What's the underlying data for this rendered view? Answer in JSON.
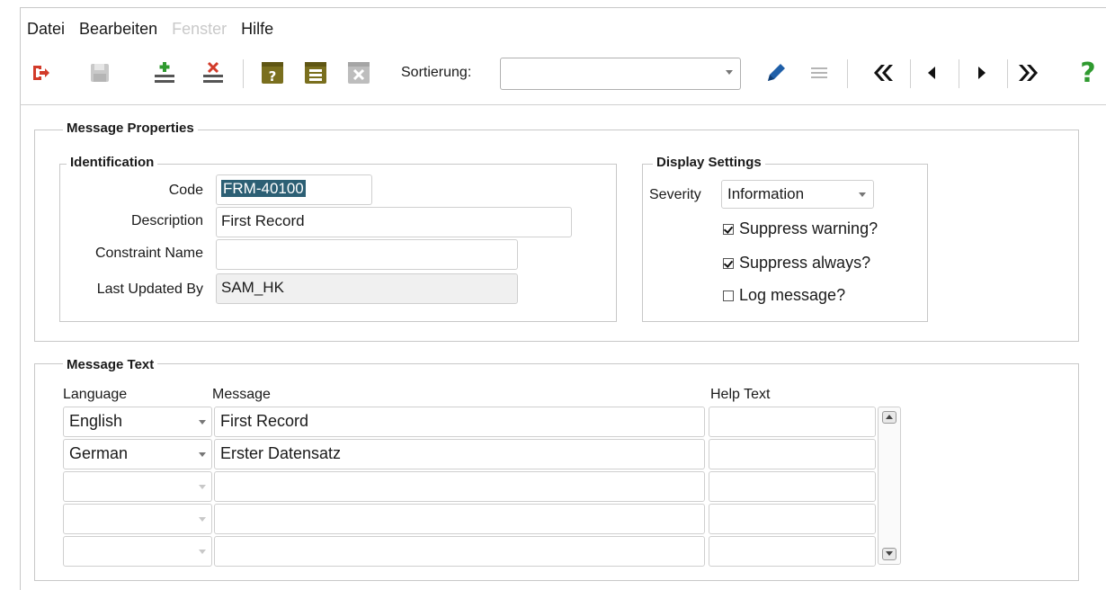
{
  "menu": {
    "items": [
      {
        "label": "Datei",
        "enabled": true
      },
      {
        "label": "Bearbeiten",
        "enabled": true
      },
      {
        "label": "Fenster",
        "enabled": false
      },
      {
        "label": "Hilfe",
        "enabled": true
      }
    ]
  },
  "toolbar": {
    "sort_label": "Sortierung:",
    "sort_value": "",
    "help_glyph": "?",
    "icons": [
      "exit-icon",
      "save-icon",
      "insert-record-icon",
      "delete-record-icon",
      "query-icon",
      "list-icon",
      "clear-icon",
      "edit-pen-icon",
      "menu-lines-icon",
      "first-record-icon",
      "previous-record-icon",
      "next-record-icon",
      "last-record-icon",
      "help-icon"
    ]
  },
  "message_properties": {
    "title": "Message Properties",
    "identification": {
      "title": "Identification",
      "code_label": "Code",
      "code_value": "FRM-40100",
      "description_label": "Description",
      "description_value": "First Record",
      "constraint_label": "Constraint Name",
      "constraint_value": "",
      "last_updated_label": "Last Updated By",
      "last_updated_value": "SAM_HK"
    },
    "display_settings": {
      "title": "Display Settings",
      "severity_label": "Severity",
      "severity_value": "Information",
      "checks": [
        {
          "label": "Suppress warning?",
          "checked": true
        },
        {
          "label": "Suppress always?",
          "checked": true
        },
        {
          "label": "Log message?",
          "checked": false
        }
      ]
    }
  },
  "message_text": {
    "title": "Message Text",
    "columns": {
      "language": "Language",
      "message": "Message",
      "help": "Help Text"
    },
    "rows": [
      {
        "language": "English",
        "message": "First Record",
        "help": ""
      },
      {
        "language": "German",
        "message": "Erster Datensatz",
        "help": ""
      },
      {
        "language": "",
        "message": "",
        "help": ""
      },
      {
        "language": "",
        "message": "",
        "help": ""
      },
      {
        "language": "",
        "message": "",
        "help": ""
      }
    ]
  },
  "colors": {
    "accent_red": "#d23b2a",
    "accent_olive": "#7a6f1e",
    "accent_blue": "#1f5fa8",
    "accent_green": "#2f9a2f",
    "selection": "#2c5f74"
  }
}
